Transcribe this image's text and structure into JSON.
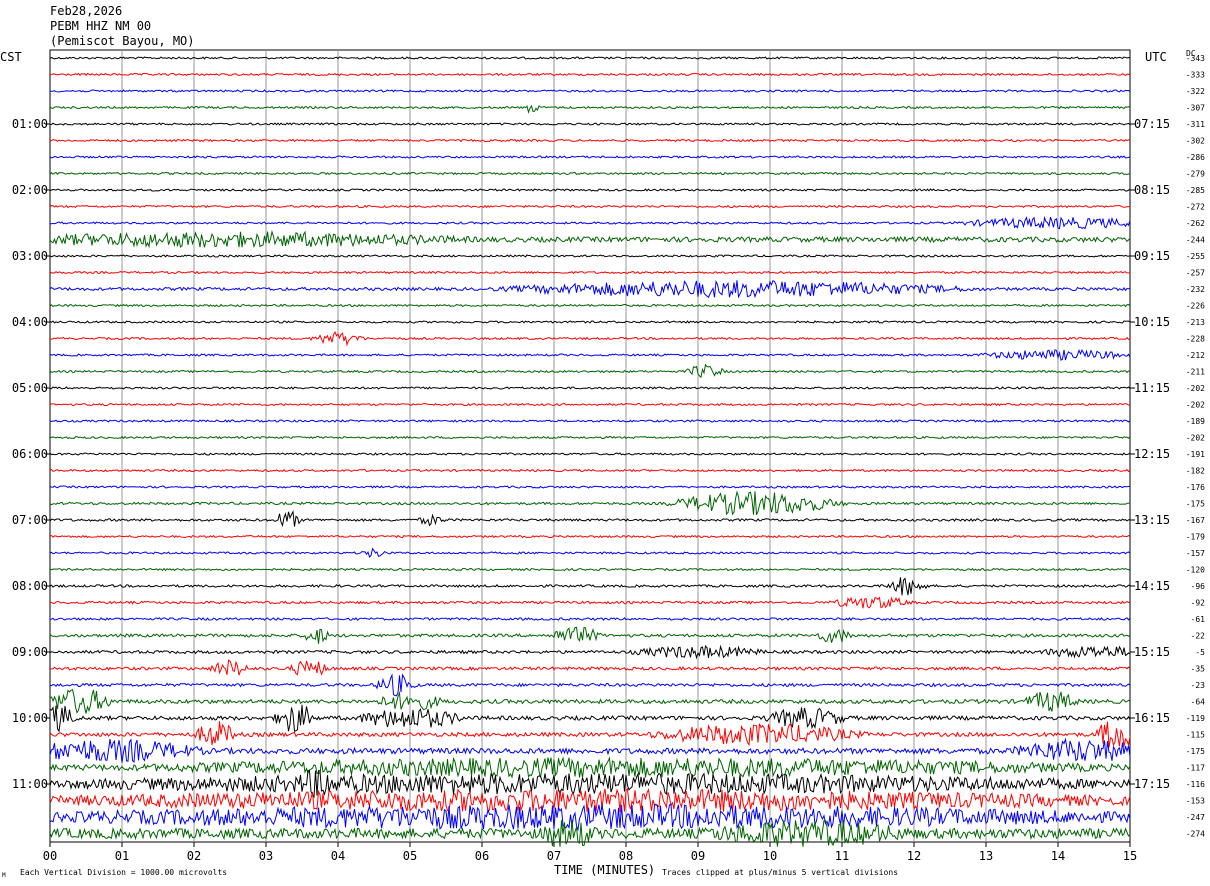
{
  "header": {
    "date": "Feb28,2026",
    "station": "PEBM HHZ NM 00",
    "location": "(Pemiscot Bayou, MO)"
  },
  "left_tz": "CST",
  "right_tz": "UTC",
  "dc_label": "DC",
  "footer": {
    "scale_note": "Each Vertical Division = 1000.00 microvolts",
    "clip_note": "Traces clipped at plus/minus 5 vertical divisions",
    "corner_mark": "M"
  },
  "colors": {
    "trace_cycle": [
      "#000000",
      "#ff0000",
      "#0000ff",
      "#006400"
    ],
    "grid": "#999999"
  },
  "chart_data": {
    "type": "line",
    "title": "PEBM HHZ NM 00",
    "xlabel": "TIME (MINUTES)",
    "ylabel": "",
    "x_range": [
      0,
      15
    ],
    "x_ticks": [
      "00",
      "01",
      "02",
      "03",
      "04",
      "05",
      "06",
      "07",
      "08",
      "09",
      "10",
      "11",
      "12",
      "13",
      "14",
      "15"
    ],
    "grid": true,
    "rows_per_hour": 4,
    "trace_count": 48,
    "left_hour_labels": [
      "01:00",
      "02:00",
      "03:00",
      "04:00",
      "05:00",
      "06:00",
      "07:00",
      "08:00",
      "09:00",
      "10:00",
      "11:00"
    ],
    "right_hour_labels": [
      "07:15",
      "08:15",
      "09:15",
      "10:15",
      "11:15",
      "12:15",
      "13:15",
      "14:15",
      "15:15",
      "16:15",
      "17:15"
    ],
    "hour_label_rows": [
      4,
      8,
      12,
      16,
      20,
      24,
      28,
      32,
      36,
      40,
      44
    ],
    "dc_offsets": [
      "-343",
      "-333",
      "-322",
      "-307",
      "-311",
      "-302",
      "-286",
      "-279",
      "-285",
      "-272",
      "-262",
      "-244",
      "-255",
      "-257",
      "-232",
      "-226",
      "-213",
      "-228",
      "-212",
      "-211",
      "-202",
      "-202",
      "-189",
      "-202",
      "-191",
      "-182",
      "-176",
      "-175",
      "-167",
      "-179",
      "-157",
      "-120",
      "-96",
      "-92",
      "-61",
      "-22",
      "-5",
      "-35",
      "-23",
      "-64",
      "-119",
      "-115",
      "-175",
      "-117",
      "-116",
      "-153",
      "-247",
      "-274"
    ],
    "series": [
      {
        "row": 0,
        "base": 1.0,
        "events": []
      },
      {
        "row": 1,
        "base": 1.0,
        "events": []
      },
      {
        "row": 2,
        "base": 1.0,
        "events": []
      },
      {
        "row": 3,
        "base": 1.0,
        "events": [
          {
            "t": 6.7,
            "w": 0.1,
            "a": 3
          }
        ]
      },
      {
        "row": 4,
        "base": 1.0,
        "events": []
      },
      {
        "row": 5,
        "base": 1.0,
        "events": []
      },
      {
        "row": 6,
        "base": 1.0,
        "events": []
      },
      {
        "row": 7,
        "base": 1.0,
        "events": []
      },
      {
        "row": 8,
        "base": 1.0,
        "events": []
      },
      {
        "row": 9,
        "base": 1.0,
        "events": []
      },
      {
        "row": 10,
        "base": 1.0,
        "events": [
          {
            "t": 14.0,
            "w": 1.5,
            "a": 2.5
          }
        ]
      },
      {
        "row": 11,
        "base": 2.5,
        "events": [
          {
            "t": 2.5,
            "w": 3.5,
            "a": 1.6
          }
        ]
      },
      {
        "row": 12,
        "base": 1.0,
        "events": []
      },
      {
        "row": 13,
        "base": 1.0,
        "events": []
      },
      {
        "row": 14,
        "base": 1.5,
        "events": [
          {
            "t": 9.5,
            "w": 3.5,
            "a": 3
          }
        ]
      },
      {
        "row": 15,
        "base": 1.0,
        "events": []
      },
      {
        "row": 16,
        "base": 1.0,
        "events": []
      },
      {
        "row": 17,
        "base": 1.0,
        "events": [
          {
            "t": 4.0,
            "w": 0.4,
            "a": 3
          }
        ]
      },
      {
        "row": 18,
        "base": 1.0,
        "events": [
          {
            "t": 14.0,
            "w": 1.2,
            "a": 2.2
          }
        ]
      },
      {
        "row": 19,
        "base": 1.0,
        "events": [
          {
            "t": 9.1,
            "w": 0.3,
            "a": 3
          }
        ]
      },
      {
        "row": 20,
        "base": 1.0,
        "events": []
      },
      {
        "row": 21,
        "base": 1.0,
        "events": []
      },
      {
        "row": 22,
        "base": 1.0,
        "events": []
      },
      {
        "row": 23,
        "base": 1.0,
        "events": []
      },
      {
        "row": 24,
        "base": 1.0,
        "events": []
      },
      {
        "row": 25,
        "base": 1.0,
        "events": []
      },
      {
        "row": 26,
        "base": 1.0,
        "events": []
      },
      {
        "row": 27,
        "base": 1.2,
        "events": [
          {
            "t": 9.8,
            "w": 1.3,
            "a": 5
          }
        ]
      },
      {
        "row": 28,
        "base": 1.2,
        "events": [
          {
            "t": 3.3,
            "w": 0.2,
            "a": 4
          },
          {
            "t": 5.3,
            "w": 0.2,
            "a": 2
          }
        ]
      },
      {
        "row": 29,
        "base": 1.0,
        "events": []
      },
      {
        "row": 30,
        "base": 1.0,
        "events": [
          {
            "t": 4.5,
            "w": 0.2,
            "a": 2
          }
        ]
      },
      {
        "row": 31,
        "base": 1.0,
        "events": []
      },
      {
        "row": 32,
        "base": 1.2,
        "events": [
          {
            "t": 11.9,
            "w": 0.3,
            "a": 4
          }
        ]
      },
      {
        "row": 33,
        "base": 1.2,
        "events": [
          {
            "t": 11.4,
            "w": 0.6,
            "a": 2.5
          }
        ]
      },
      {
        "row": 34,
        "base": 1.2,
        "events": []
      },
      {
        "row": 35,
        "base": 1.5,
        "events": [
          {
            "t": 3.7,
            "w": 0.2,
            "a": 3
          },
          {
            "t": 7.3,
            "w": 0.4,
            "a": 3
          },
          {
            "t": 10.9,
            "w": 0.3,
            "a": 2.5
          }
        ]
      },
      {
        "row": 36,
        "base": 1.5,
        "events": [
          {
            "t": 9.0,
            "w": 1.0,
            "a": 2
          },
          {
            "t": 14.5,
            "w": 0.8,
            "a": 2
          }
        ]
      },
      {
        "row": 37,
        "base": 1.5,
        "events": [
          {
            "t": 2.5,
            "w": 0.3,
            "a": 3
          },
          {
            "t": 3.6,
            "w": 0.3,
            "a": 3
          }
        ]
      },
      {
        "row": 38,
        "base": 1.5,
        "events": [
          {
            "t": 4.8,
            "w": 0.3,
            "a": 4
          }
        ]
      },
      {
        "row": 39,
        "base": 2.0,
        "events": [
          {
            "t": 0.4,
            "w": 0.5,
            "a": 4
          },
          {
            "t": 5.0,
            "w": 0.5,
            "a": 2.5
          },
          {
            "t": 13.9,
            "w": 0.4,
            "a": 3
          }
        ]
      },
      {
        "row": 40,
        "base": 2.0,
        "events": [
          {
            "t": 0.1,
            "w": 0.3,
            "a": 4
          },
          {
            "t": 3.4,
            "w": 0.3,
            "a": 5
          },
          {
            "t": 5.0,
            "w": 0.8,
            "a": 3
          },
          {
            "t": 10.5,
            "w": 0.6,
            "a": 3
          }
        ]
      },
      {
        "row": 41,
        "base": 2.0,
        "events": [
          {
            "t": 2.3,
            "w": 0.3,
            "a": 4
          },
          {
            "t": 9.8,
            "w": 1.6,
            "a": 3
          },
          {
            "t": 14.8,
            "w": 0.3,
            "a": 5
          }
        ]
      },
      {
        "row": 42,
        "base": 2.8,
        "events": [
          {
            "t": 0.8,
            "w": 1.4,
            "a": 2.5
          },
          {
            "t": 14.3,
            "w": 1.0,
            "a": 2.5
          }
        ]
      },
      {
        "row": 43,
        "base": 3.0,
        "events": [
          {
            "t": 8.0,
            "w": 7.0,
            "a": 1.8
          }
        ]
      },
      {
        "row": 44,
        "base": 4.0,
        "events": [
          {
            "t": 3.7,
            "w": 0.3,
            "a": 3
          },
          {
            "t": 7.5,
            "w": 7.5,
            "a": 1.4
          }
        ]
      },
      {
        "row": 45,
        "base": 4.5,
        "events": [
          {
            "t": 7.5,
            "w": 7.5,
            "a": 1.3
          }
        ]
      },
      {
        "row": 46,
        "base": 5.0,
        "events": [
          {
            "t": 7.5,
            "w": 7.5,
            "a": 1.3
          }
        ]
      },
      {
        "row": 47,
        "base": 5.0,
        "events": [
          {
            "t": 7.2,
            "w": 0.4,
            "a": 2
          },
          {
            "t": 10.5,
            "w": 1.5,
            "a": 1.5
          }
        ]
      }
    ]
  }
}
